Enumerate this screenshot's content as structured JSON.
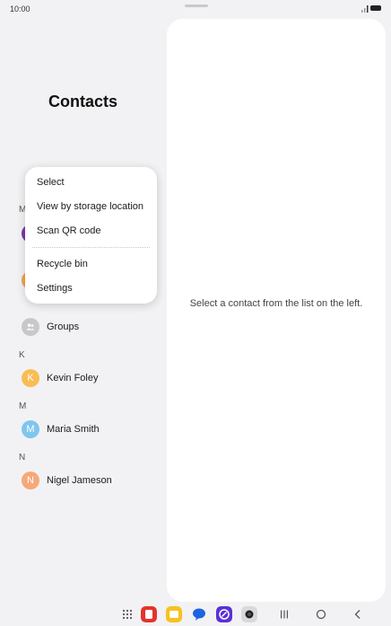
{
  "status_bar": {
    "time": "10:00"
  },
  "contacts": {
    "title": "Contacts",
    "sections": [
      {
        "letter": "M"
      },
      {
        "letter": "K"
      },
      {
        "letter": "M"
      },
      {
        "letter": "N"
      }
    ],
    "groups_label": "Groups",
    "people": [
      {
        "initial": "K",
        "name": "Kevin Foley",
        "color": "#f9bd55"
      },
      {
        "initial": "M",
        "name": "Maria Smith",
        "color": "#7fc6ef"
      },
      {
        "initial": "N",
        "name": "Nigel Jameson",
        "color": "#f5a97a"
      }
    ],
    "hidden_avatar_colors": [
      "#7b3aa0",
      "#f3a347"
    ]
  },
  "menu": {
    "items": [
      "Select",
      "View by storage location",
      "Scan QR code",
      "Recycle bin",
      "Settings"
    ]
  },
  "detail": {
    "empty_message": "Select a contact from the list on the left."
  },
  "colors": {
    "background": "#f2f2f4",
    "panel": "#ffffff",
    "groups_icon": "#c8c8cc"
  },
  "nav_bar": {
    "apps": [
      "apps-grid-icon",
      "red-app-icon",
      "yellow-app-icon",
      "chat-app-icon",
      "purple-app-icon",
      "camera-app-icon"
    ],
    "buttons": [
      "recents-icon",
      "home-icon",
      "back-icon"
    ]
  }
}
